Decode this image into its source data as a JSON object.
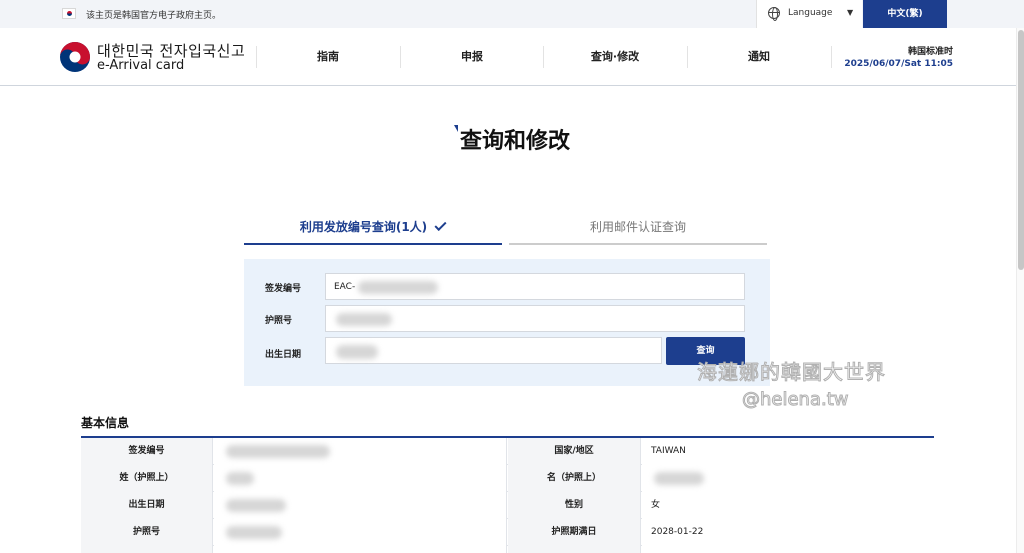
{
  "gov_banner": {
    "notice": "该主页是韩国官方电子政府主页。",
    "language_label": "Language",
    "current_language": "中文(繁)"
  },
  "header": {
    "brand_korean": "대한민국 전자입국신고",
    "brand_english": "e-Arrival card",
    "nav": [
      "指南",
      "申报",
      "查询·修改",
      "通知"
    ],
    "timezone_label": "韩国标准时",
    "datetime": "2025/06/07/Sat 11:05"
  },
  "page": {
    "title": "查询和修改"
  },
  "tabs": [
    {
      "label": "利用发放编号查询(1人)",
      "active": true
    },
    {
      "label": "利用邮件认证查询",
      "active": false
    }
  ],
  "search_form": {
    "issue_no_label": "签发编号",
    "issue_no_value": "EAC-",
    "passport_label": "护照号",
    "birth_label": "出生日期",
    "query_button": "查询"
  },
  "watermark": {
    "line1": "海蓮娜的韓國大世界",
    "line2": "@helena.tw"
  },
  "basic_info": {
    "title": "基本信息",
    "rows": [
      {
        "label_left": "签发编号",
        "value_left": "",
        "label_right": "国家/地区",
        "value_right": "TAIWAN"
      },
      {
        "label_left": "姓（护照上）",
        "value_left": "",
        "label_right": "名（护照上）",
        "value_right": ""
      },
      {
        "label_left": "出生日期",
        "value_left": "",
        "label_right": "性别",
        "value_right": "女"
      },
      {
        "label_left": "护照号",
        "value_left": "",
        "label_right": "护照期满日",
        "value_right": "2028-01-22"
      }
    ]
  },
  "colors": {
    "primary": "#1d3e8e",
    "form_bg": "#eaf2fb",
    "gov_bar_bg": "#f2f4f8"
  }
}
